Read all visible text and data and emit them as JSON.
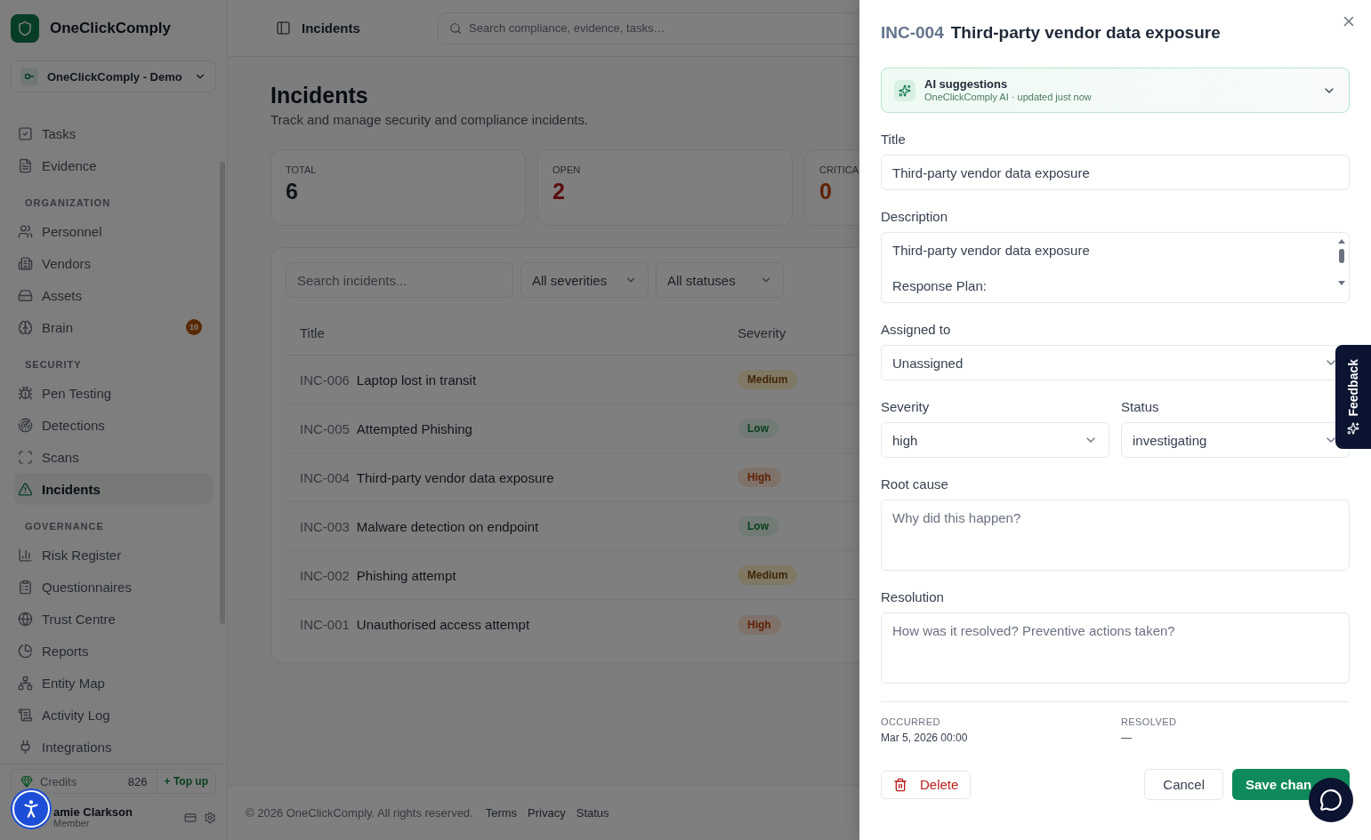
{
  "sidebar": {
    "brand": "OneClickComply",
    "workspace": "OneClickComply - Demo",
    "sections": [
      {
        "items": [
          {
            "label": "Tasks",
            "selected": false
          },
          {
            "label": "Evidence",
            "selected": false
          }
        ]
      },
      {
        "heading": "ORGANIZATION",
        "items": [
          {
            "label": "Personnel",
            "selected": false
          },
          {
            "label": "Vendors",
            "selected": false
          },
          {
            "label": "Assets",
            "selected": false
          },
          {
            "label": "Brain",
            "selected": false,
            "badge": "10"
          }
        ]
      },
      {
        "heading": "SECURITY",
        "items": [
          {
            "label": "Pen Testing",
            "selected": false
          },
          {
            "label": "Detections",
            "selected": false
          },
          {
            "label": "Scans",
            "selected": false
          },
          {
            "label": "Incidents",
            "selected": true
          }
        ]
      },
      {
        "heading": "GOVERNANCE",
        "items": [
          {
            "label": "Risk Register",
            "selected": false
          },
          {
            "label": "Questionnaires",
            "selected": false
          },
          {
            "label": "Trust Centre",
            "selected": false
          },
          {
            "label": "Reports",
            "selected": false
          },
          {
            "label": "Entity Map",
            "selected": false
          },
          {
            "label": "Activity Log",
            "selected": false
          },
          {
            "label": "Integrations",
            "selected": false
          }
        ]
      }
    ],
    "credits": {
      "label": "Credits",
      "value": "826",
      "action": "+ Top up"
    },
    "user": {
      "name": "amie Clarkson",
      "role": "Member"
    }
  },
  "topbar": {
    "title": "Incidents",
    "search_placeholder": "Search compliance, evidence, tasks…"
  },
  "page": {
    "title": "Incidents",
    "subtitle": "Track and manage security and compliance incidents.",
    "stats": [
      {
        "label": "TOTAL",
        "value": "6",
        "kind": "neutral"
      },
      {
        "label": "OPEN",
        "value": "2",
        "kind": "danger"
      },
      {
        "label": "CRITICA",
        "value": "0",
        "kind": "warning"
      }
    ],
    "filters": {
      "search_placeholder": "Search incidents...",
      "selects": [
        "All severities",
        "All statuses"
      ]
    },
    "table": {
      "columns": [
        "Title",
        "Severity"
      ],
      "rows": [
        {
          "id": "INC-006",
          "title": "Laptop lost in transit",
          "severity": "Medium",
          "kind": "medium"
        },
        {
          "id": "INC-005",
          "title": "Attempted Phishing",
          "severity": "Low",
          "kind": "low"
        },
        {
          "id": "INC-004",
          "title": "Third-party vendor data exposure",
          "severity": "High",
          "kind": "high"
        },
        {
          "id": "INC-003",
          "title": "Malware detection on endpoint",
          "severity": "Low",
          "kind": "low"
        },
        {
          "id": "INC-002",
          "title": "Phishing attempt",
          "severity": "Medium",
          "kind": "medium"
        },
        {
          "id": "INC-001",
          "title": "Unauthorised access attempt",
          "severity": "High",
          "kind": "high"
        }
      ]
    }
  },
  "footer": {
    "copyright": "© 2026 OneClickComply. All rights reserved.",
    "links": [
      "Terms",
      "Privacy",
      "Status"
    ]
  },
  "drawer": {
    "id": "INC-004",
    "title": "Third-party vendor data exposure",
    "ai": {
      "title": "AI suggestions",
      "subtitle": "OneClickComply AI · updated just now",
      "expanded": false
    },
    "title_field": {
      "label": "Title",
      "value": "Third-party vendor data exposure"
    },
    "description": {
      "label": "Description",
      "value": "Third-party vendor data exposure\n\nResponse Plan:"
    },
    "assigned": {
      "label": "Assigned to",
      "value": "Unassigned"
    },
    "severity": {
      "label": "Severity",
      "value": "high"
    },
    "status": {
      "label": "Status",
      "value": "investigating"
    },
    "root_cause": {
      "label": "Root cause",
      "placeholder": "Why did this happen?"
    },
    "resolution": {
      "label": "Resolution",
      "placeholder": "How was it resolved? Preventive actions taken?"
    },
    "meta": [
      {
        "label": "OCCURRED",
        "value": "Mar 5, 2026 00:00"
      },
      {
        "label": "RESOLVED",
        "value": "—"
      }
    ],
    "buttons": {
      "delete": "Delete",
      "cancel": "Cancel",
      "save": "Save chan"
    }
  },
  "feedback": {
    "label": "Feedback"
  }
}
